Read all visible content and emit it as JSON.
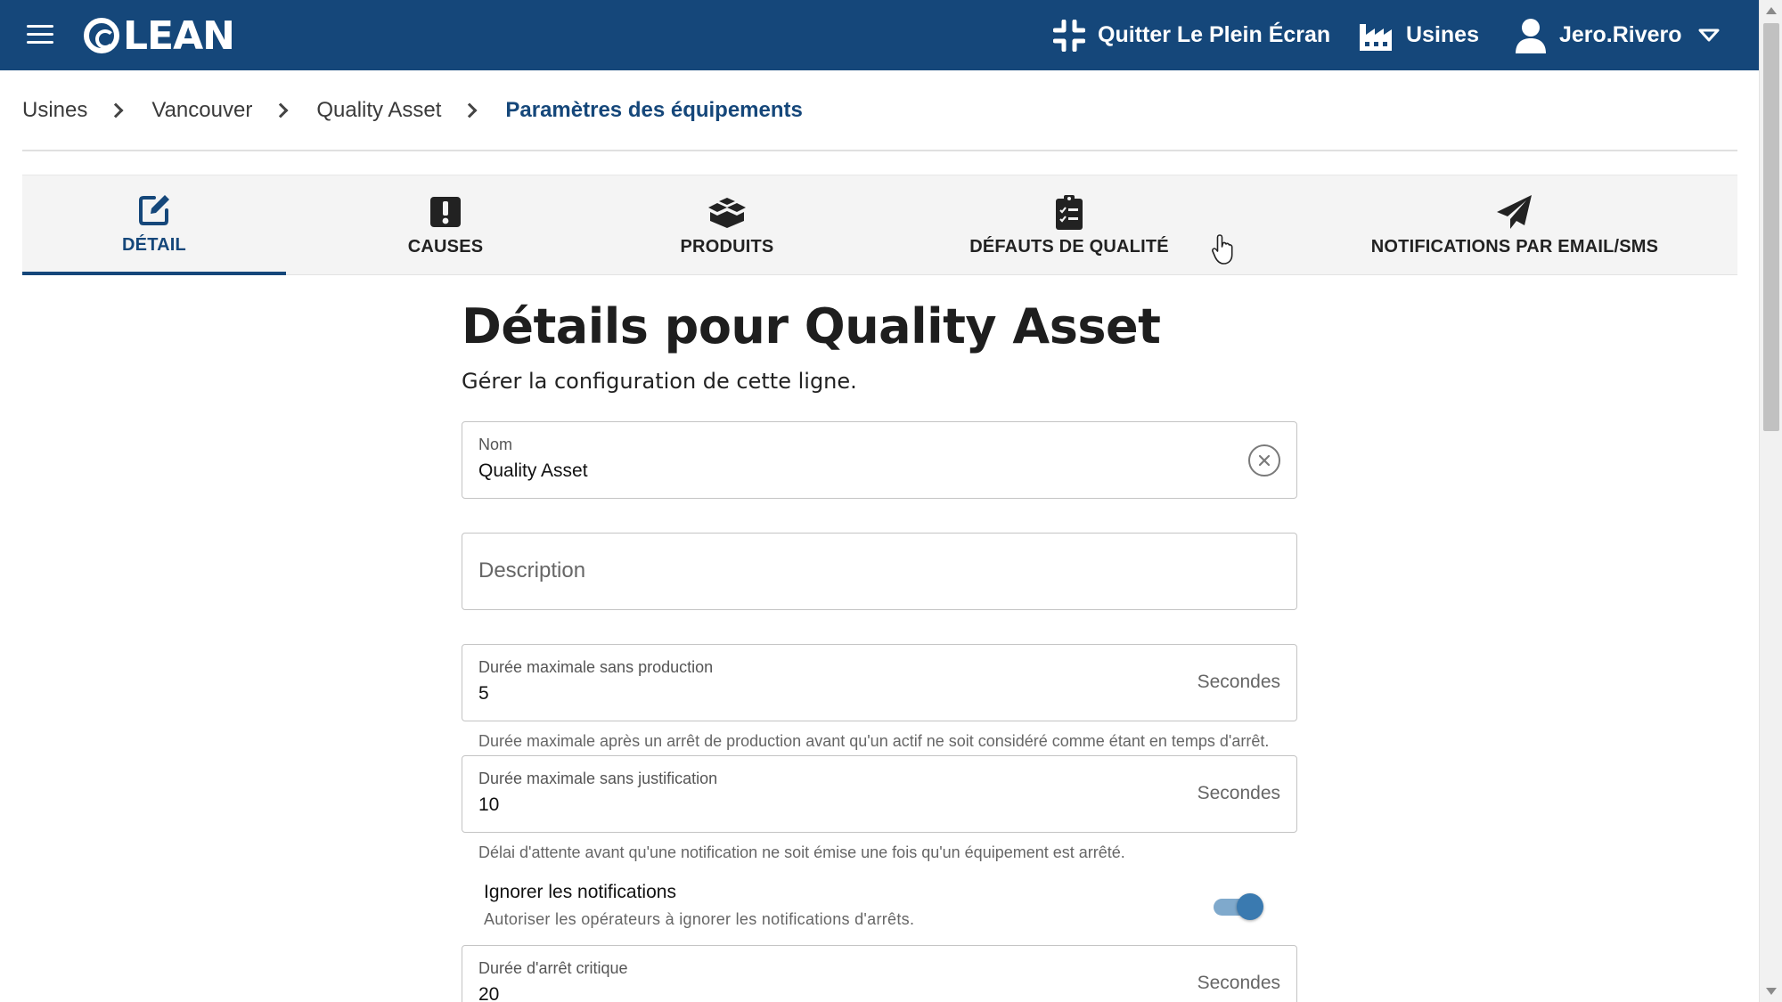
{
  "app": {
    "logo_text": "LEAN",
    "brand_color": "#15477a"
  },
  "topbar": {
    "fullscreen_label": "Quitter Le Plein Écran",
    "plants_label": "Usines",
    "user_name": "Jero.Rivero"
  },
  "breadcrumb": {
    "items": [
      "Usines",
      "Vancouver",
      "Quality Asset"
    ],
    "current": "Paramètres des équipements"
  },
  "tabs": [
    {
      "label": "DÉTAIL",
      "icon": "edit-icon",
      "active": true
    },
    {
      "label": "CAUSES",
      "icon": "exclamation-icon",
      "active": false
    },
    {
      "label": "PRODUITS",
      "icon": "boxes-icon",
      "active": false
    },
    {
      "label": "DÉFAUTS DE QUALITÉ",
      "icon": "clipboard-check-icon",
      "active": false
    },
    {
      "label": "NOTIFICATIONS PAR EMAIL/SMS",
      "icon": "paper-plane-icon",
      "active": false
    }
  ],
  "main": {
    "title": "Détails pour Quality Asset",
    "subtitle": "Gérer la configuration de cette ligne.",
    "name_field": {
      "label": "Nom",
      "value": "Quality Asset"
    },
    "description_field": {
      "placeholder": "Description"
    },
    "max_no_production": {
      "label": "Durée maximale sans production",
      "value": "5",
      "suffix": "Secondes",
      "helper": "Durée maximale après un arrêt de production avant qu'un actif ne soit considéré comme étant en temps d'arrêt."
    },
    "max_no_justification": {
      "label": "Durée maximale sans justification",
      "value": "10",
      "suffix": "Secondes",
      "helper": "Délai d'attente avant qu'une notification ne soit émise une fois qu'un équipement est arrêté."
    },
    "ignore_notifications": {
      "title": "Ignorer les notifications",
      "description": "Autoriser les opérateurs à ignorer les notifications d'arrêts.",
      "enabled": true
    },
    "critical_downtime": {
      "label": "Durée d'arrêt critique",
      "value": "20",
      "suffix": "Secondes"
    }
  }
}
